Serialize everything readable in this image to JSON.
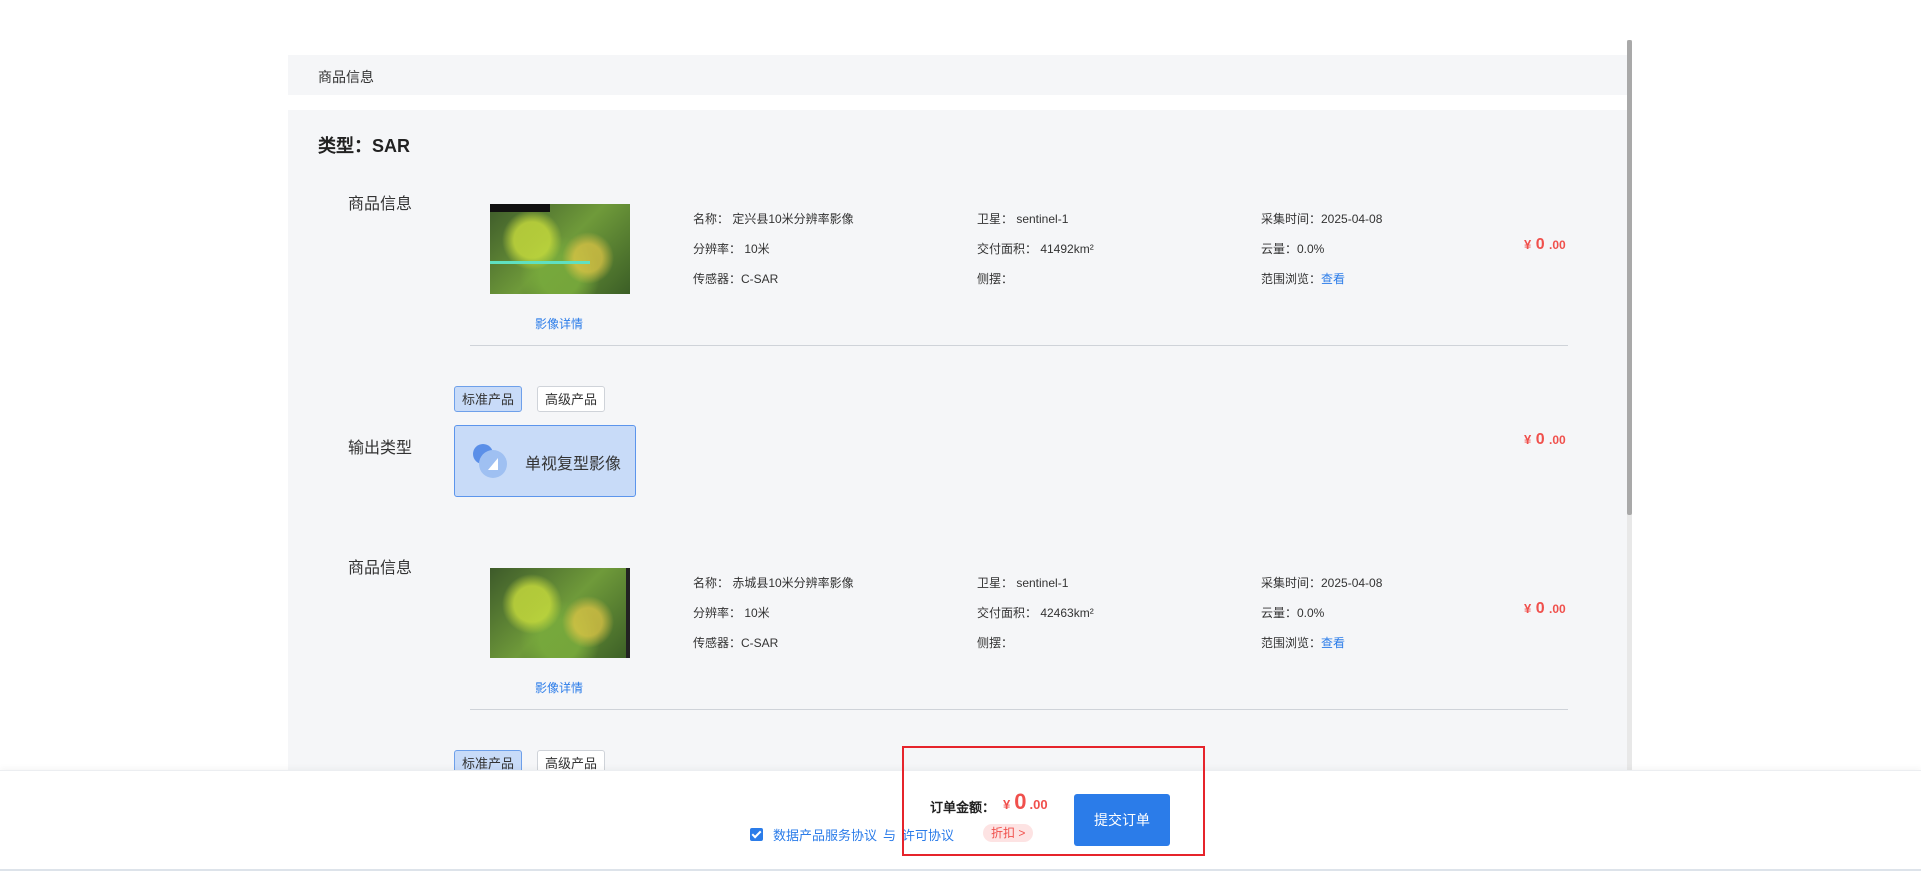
{
  "header": {
    "title": "商品信息"
  },
  "type_title": "类型：SAR",
  "products": [
    {
      "section_label": "商品信息",
      "detail_link": "影像详情",
      "name": "名称： 定兴县10米分辨率影像",
      "resolution": "分辨率： 10米",
      "sensor": "传感器：C-SAR",
      "satellite": "卫星： sentinel-1",
      "area": "交付面积： 41492km²",
      "side_swing": "侧摆：",
      "capture_time": "采集时间：2025-04-08",
      "cloud": "云量：0.0%",
      "range_label": "范围浏览：",
      "range_link": "查看",
      "price": {
        "currency": "¥",
        "integer": "0",
        "decimal": ".00"
      }
    },
    {
      "section_label": "商品信息",
      "detail_link": "影像详情",
      "name": "名称： 赤城县10米分辨率影像",
      "resolution": "分辨率： 10米",
      "sensor": "传感器：C-SAR",
      "satellite": "卫星： sentinel-1",
      "area": "交付面积： 42463km²",
      "side_swing": "侧摆：",
      "capture_time": "采集时间：2025-04-08",
      "cloud": "云量：0.0%",
      "range_label": "范围浏览：",
      "range_link": "查看",
      "price": {
        "currency": "¥",
        "integer": "0",
        "decimal": ".00"
      }
    }
  ],
  "output": {
    "section_label": "输出类型",
    "tabs": [
      "标准产品",
      "高级产品"
    ],
    "active_tab": "标准产品",
    "card_label": "单视复型影像",
    "price": {
      "currency": "¥",
      "integer": "0",
      "decimal": ".00"
    }
  },
  "footer": {
    "agreement_1": "数据产品服务协议",
    "agreement_sep": "与",
    "agreement_2": "许可协议",
    "discount": "折扣 >",
    "order_label": "订单金额：",
    "order_price": {
      "currency": "¥",
      "integer": "0",
      "decimal": ".00"
    },
    "submit_label": "提交订单"
  },
  "colors": {
    "accent": "#2b7ce9",
    "price": "#f0504c",
    "highlight": "#e6242b"
  }
}
